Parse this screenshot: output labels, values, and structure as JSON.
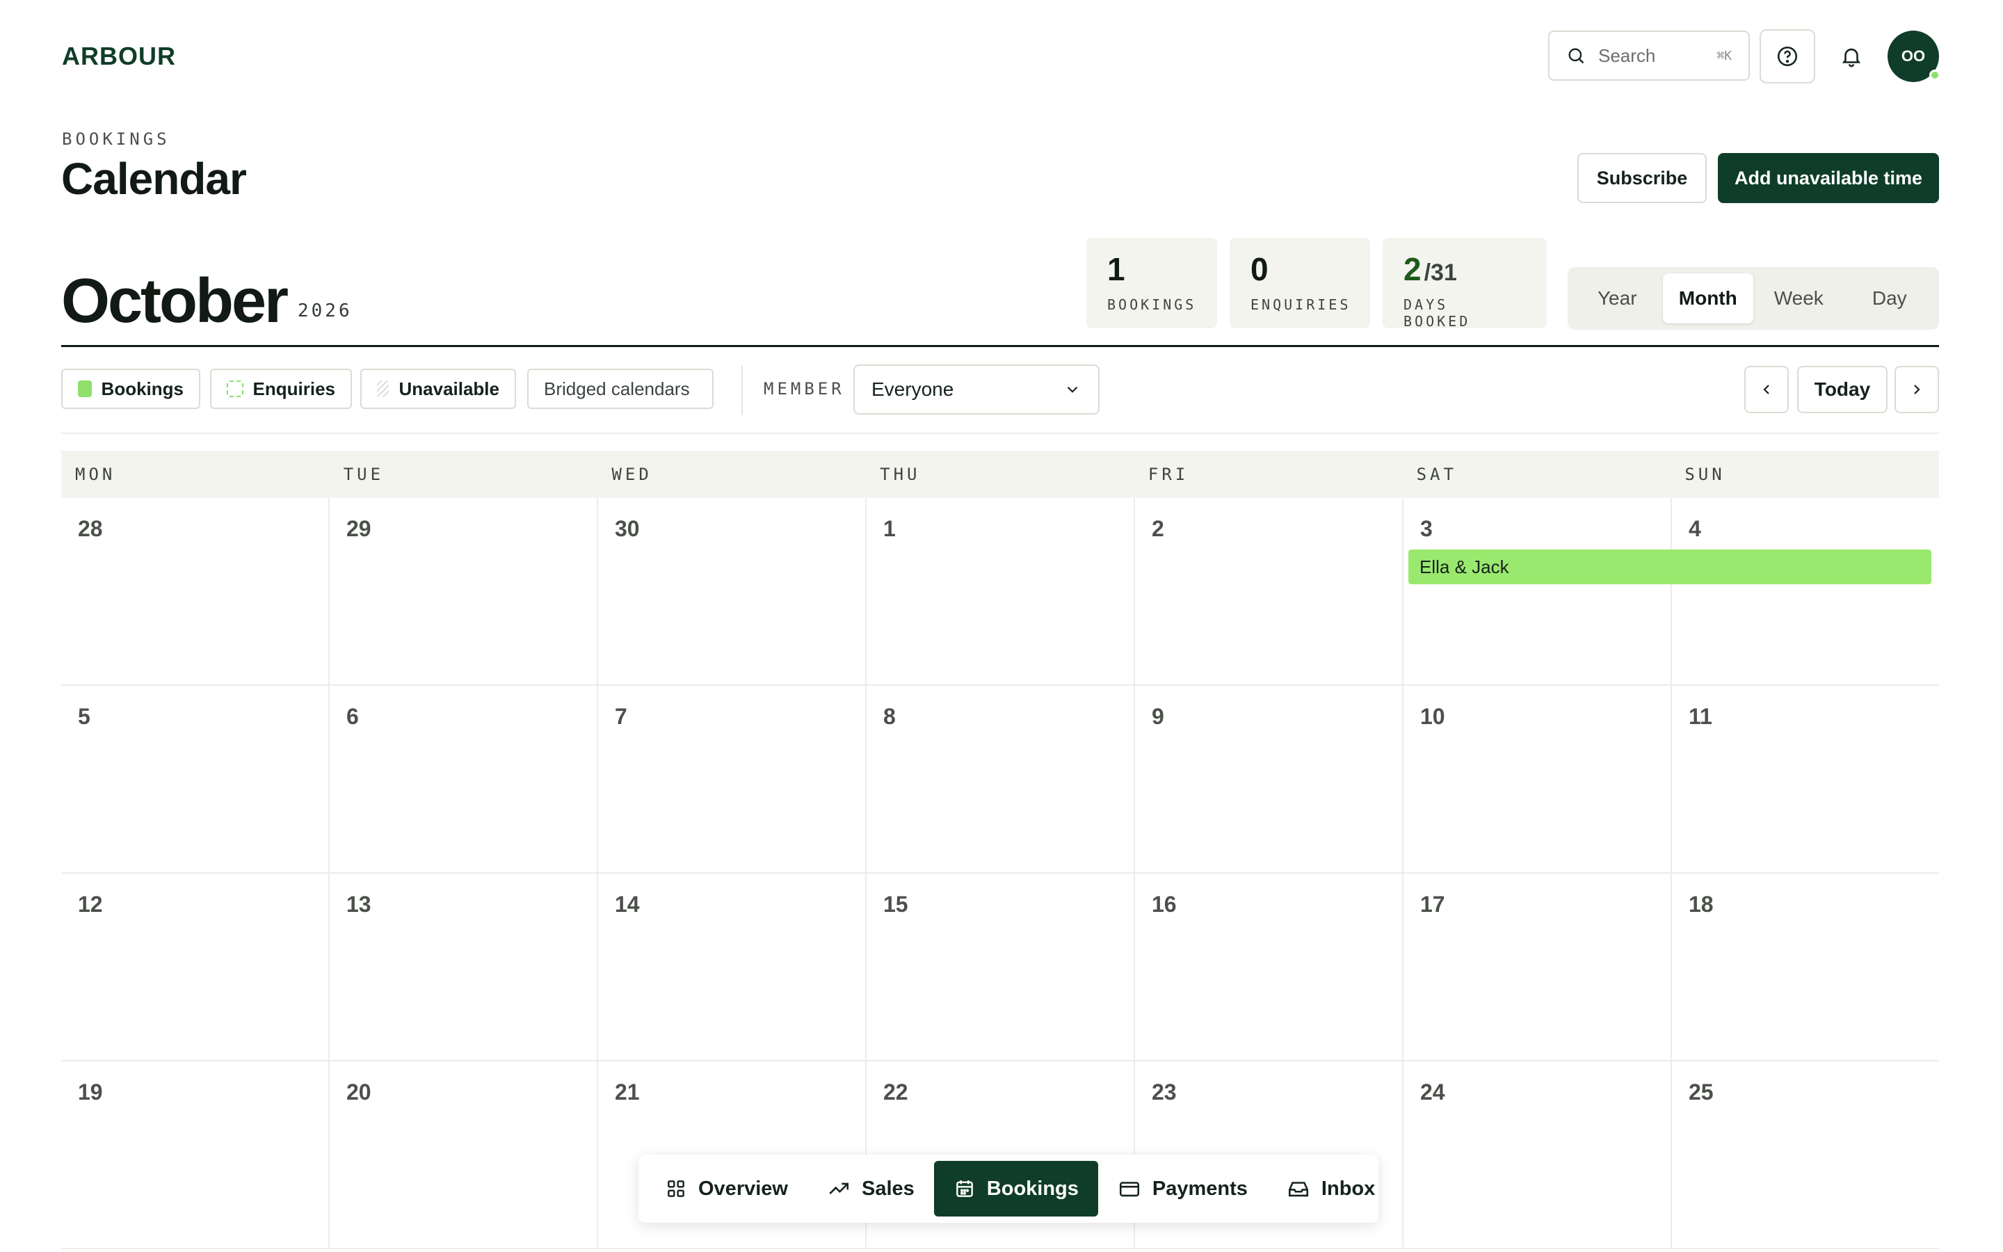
{
  "brand": {
    "logo": "ARBOUR",
    "primary": "#0f3d2a",
    "accent": "#8ee06a"
  },
  "header": {
    "search_label": "Search",
    "search_shortcut": "⌘K",
    "avatar_initials": "OO"
  },
  "page": {
    "section": "BOOKINGS",
    "title": "Calendar",
    "subscribe_label": "Subscribe",
    "add_label": "Add unavailable time"
  },
  "period": {
    "month": "October",
    "year": "2026"
  },
  "stats": {
    "bookings": {
      "value": "1",
      "label": "BOOKINGS"
    },
    "enquiries": {
      "value": "0",
      "label": "ENQUIRIES"
    },
    "days_booked": {
      "value": "2",
      "total": "/31",
      "label": "DAYS BOOKED"
    }
  },
  "views": {
    "year": "Year",
    "month": "Month",
    "week": "Week",
    "day": "Day",
    "selected": "Month"
  },
  "filters": {
    "bookings": "Bookings",
    "enquiries": "Enquiries",
    "unavailable": "Unavailable",
    "bridged": "Bridged calendars"
  },
  "member": {
    "label": "MEMBER",
    "value": "Everyone"
  },
  "nav": {
    "today": "Today"
  },
  "weekdays": [
    "MON",
    "TUE",
    "WED",
    "THU",
    "FRI",
    "SAT",
    "SUN"
  ],
  "weeks": [
    [
      "28",
      "29",
      "30",
      "1",
      "2",
      "3",
      "4"
    ],
    [
      "5",
      "6",
      "7",
      "8",
      "9",
      "10",
      "11"
    ],
    [
      "12",
      "13",
      "14",
      "15",
      "16",
      "17",
      "18"
    ],
    [
      "19",
      "20",
      "21",
      "22",
      "23",
      "24",
      "25"
    ]
  ],
  "events": [
    {
      "title": "Ella & Jack"
    }
  ],
  "bottom_nav": {
    "overview": "Overview",
    "sales": "Sales",
    "bookings": "Bookings",
    "payments": "Payments",
    "inbox": "Inbox",
    "active": "Bookings"
  }
}
